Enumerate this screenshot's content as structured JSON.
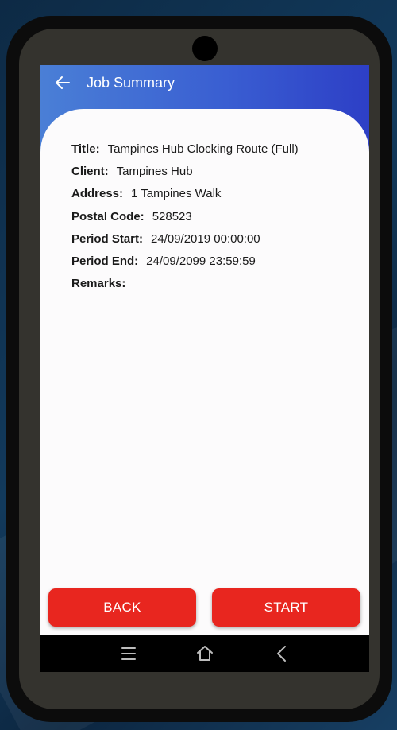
{
  "appbar": {
    "title": "Job Summary"
  },
  "job": {
    "fields": [
      {
        "label": "Title:",
        "value": "Tampines Hub Clocking Route (Full)"
      },
      {
        "label": "Client:",
        "value": "Tampines Hub"
      },
      {
        "label": "Address:",
        "value": "1 Tampines Walk"
      },
      {
        "label": "Postal Code:",
        "value": "528523"
      },
      {
        "label": "Period Start:",
        "value": "24/09/2019 00:00:00"
      },
      {
        "label": "Period End:",
        "value": "24/09/2099 23:59:59"
      },
      {
        "label": "Remarks:",
        "value": ""
      }
    ]
  },
  "buttons": {
    "back_label": "BACK",
    "start_label": "START"
  },
  "colors": {
    "appbar_start": "#4a7fd6",
    "appbar_end": "#2d3fc6",
    "button": "#e8261f",
    "phone_body": "#34332e"
  },
  "icons": {
    "back": "arrow-left-icon",
    "nav_menu": "menu-icon",
    "nav_home": "home-icon",
    "nav_back": "chevron-left-icon"
  }
}
